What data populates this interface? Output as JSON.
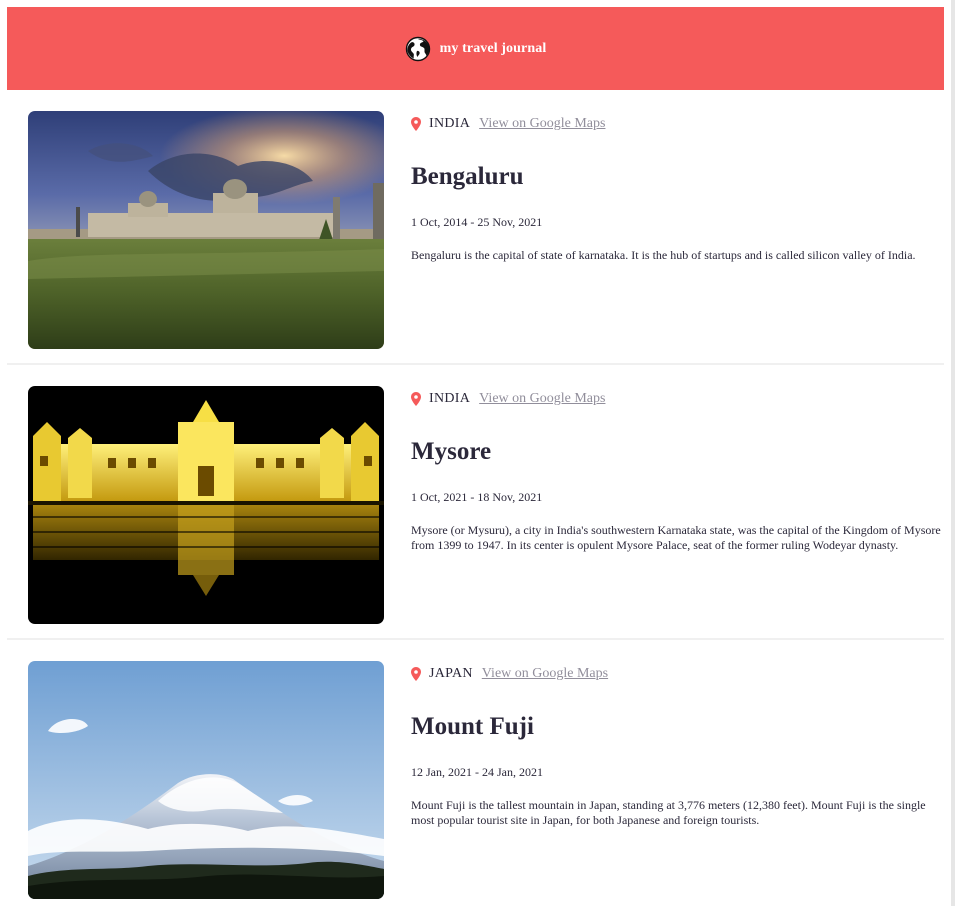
{
  "header": {
    "title": "my travel journal",
    "icon": "globe-icon",
    "color": "#f55a5a"
  },
  "accent": "#f55a5a",
  "entries": [
    {
      "country": "INDIA",
      "maps_label": "View on Google Maps",
      "title": "Bengaluru",
      "dates": "1 Oct, 2014 - 25 Nov, 2021",
      "description": "Bengaluru is the capital of state of karnataka. It is the hub of startups and is called silicon valley of India."
    },
    {
      "country": "INDIA",
      "maps_label": "View on Google Maps",
      "title": "Mysore",
      "dates": "1 Oct, 2021 - 18 Nov, 2021",
      "description": "Mysore (or Mysuru), a city in India's southwestern Karnataka state, was the capital of the Kingdom of Mysore from 1399 to 1947. In its center is opulent Mysore Palace, seat of the former ruling Wodeyar dynasty."
    },
    {
      "country": "JAPAN",
      "maps_label": "View on Google Maps",
      "title": "Mount Fuji",
      "dates": "12 Jan, 2021 - 24 Jan, 2021",
      "description": "Mount Fuji is the tallest mountain in Japan, standing at 3,776 meters (12,380 feet). Mount Fuji is the single most popular tourist site in Japan, for both Japanese and foreign tourists."
    }
  ]
}
